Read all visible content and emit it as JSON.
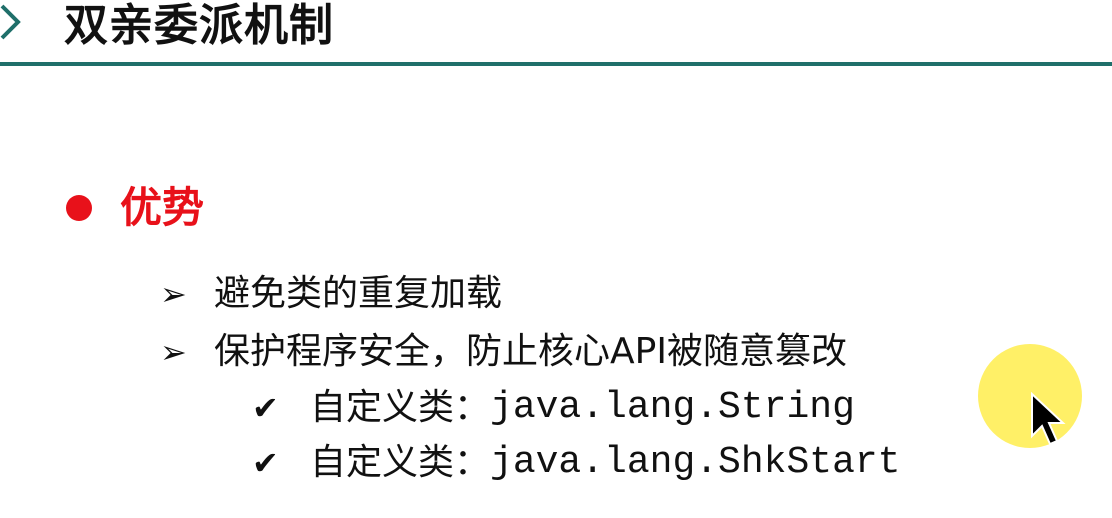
{
  "slide": {
    "title": "双亲委派机制",
    "section": {
      "label": "优势",
      "items": [
        {
          "text": "避免类的重复加载"
        },
        {
          "text": "保护程序安全，防止核心API被随意篡改",
          "subitems": [
            {
              "label": "自定义类：",
              "code": "java.lang.String"
            },
            {
              "label": "自定义类：",
              "code": "java.lang.ShkStart"
            }
          ]
        }
      ]
    }
  },
  "icons": {
    "title": "chevron-right-icon",
    "level1": "bullet-dot-icon",
    "level2": "arrowhead-icon",
    "level3": "checkmark-icon",
    "pointer": "mouse-pointer-icon"
  },
  "colors": {
    "title_text": "#111111",
    "rule": "#1f6f6a",
    "accent_red": "#e8111a",
    "body_text": "#111111",
    "cursor_halo": "#ffec3c"
  }
}
